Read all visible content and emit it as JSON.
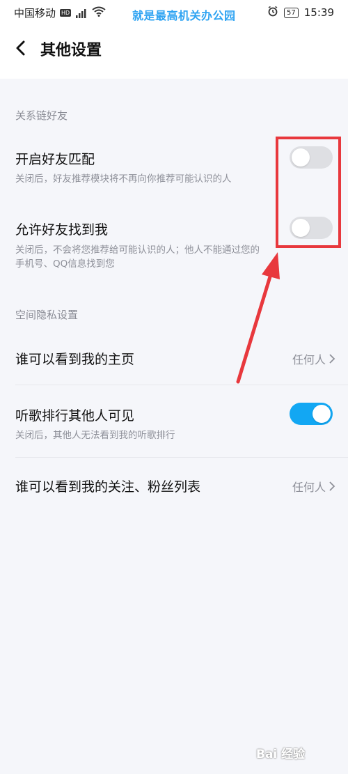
{
  "status_bar": {
    "carrier": "中国移动",
    "banner": "就是最高机关办公园",
    "battery": "57",
    "time": "15:39"
  },
  "header": {
    "title": "其他设置"
  },
  "section_friends": {
    "title": "关系链好友",
    "items": [
      {
        "title": "开启好友匹配",
        "desc": "关闭后，好友推荐模块将不再向你推荐可能认识的人",
        "enabled": false
      },
      {
        "title": "允许好友找到我",
        "desc": "关闭后，不会将您推荐给可能认识的人；他人不能通过您的手机号、QQ信息找到您",
        "enabled": false
      }
    ]
  },
  "section_space": {
    "title": "空间隐私设置",
    "items": [
      {
        "title": "谁可以看到我的主页",
        "value": "任何人"
      },
      {
        "title": "听歌排行其他人可见",
        "desc": "关闭后，其他人无法看到我的听歌排行",
        "enabled": true
      },
      {
        "title": "谁可以看到我的关注、粉丝列表",
        "value": "任何人"
      }
    ]
  },
  "colors": {
    "toggle_on": "#12a7f3",
    "toggle_off": "#dedfe3",
    "annotation": "#e8383d"
  },
  "watermark": "Bai 经验"
}
